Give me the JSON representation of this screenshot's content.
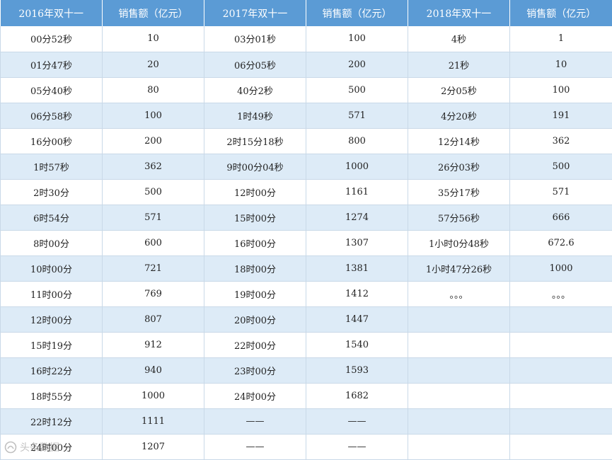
{
  "headers": [
    "2016年双十一",
    "销售额（亿元）",
    "2017年双十一",
    "销售额（亿元）",
    "2018年双十一",
    "销售额（亿元）"
  ],
  "rows": [
    [
      "00分52秒",
      "10",
      "03分01秒",
      "100",
      "4秒",
      "1"
    ],
    [
      "01分47秒",
      "20",
      "06分05秒",
      "200",
      "21秒",
      "10"
    ],
    [
      "05分40秒",
      "80",
      "40分2秒",
      "500",
      "2分05秒",
      "100"
    ],
    [
      "06分58秒",
      "100",
      "1时49秒",
      "571",
      "4分20秒",
      "191"
    ],
    [
      "16分00秒",
      "200",
      "2时15分18秒",
      "800",
      "12分14秒",
      "362"
    ],
    [
      "1时57秒",
      "362",
      "9时00分04秒",
      "1000",
      "26分03秒",
      "500"
    ],
    [
      "2时30分",
      "500",
      "12时00分",
      "1161",
      "35分17秒",
      "571"
    ],
    [
      "6时54分",
      "571",
      "15时00分",
      "1274",
      "57分56秒",
      "666"
    ],
    [
      "8时00分",
      "600",
      "16时00分",
      "1307",
      "1小时0分48秒",
      "672.6"
    ],
    [
      "10时00分",
      "721",
      "18时00分",
      "1381",
      "1小时47分26秒",
      "1000"
    ],
    [
      "11时00分",
      "769",
      "19时00分",
      "1412",
      "。。。",
      "。。。"
    ],
    [
      "12时00分",
      "807",
      "20时00分",
      "1447",
      "",
      ""
    ],
    [
      "15时19分",
      "912",
      "22时00分",
      "1540",
      "",
      ""
    ],
    [
      "16时22分",
      "940",
      "23时00分",
      "1593",
      "",
      ""
    ],
    [
      "18时55分",
      "1000",
      "24时00分",
      "1682",
      "",
      ""
    ],
    [
      "22时12分",
      "1111",
      "——",
      "——",
      "",
      ""
    ],
    [
      "24时00分",
      "1207",
      "——",
      "——",
      "",
      ""
    ]
  ],
  "colors": {
    "header_bg": "#5b9bd5",
    "row_alt_bg": "#ddebf7",
    "row_bg": "#ffffff"
  },
  "watermark": {
    "text": "头条数据"
  }
}
